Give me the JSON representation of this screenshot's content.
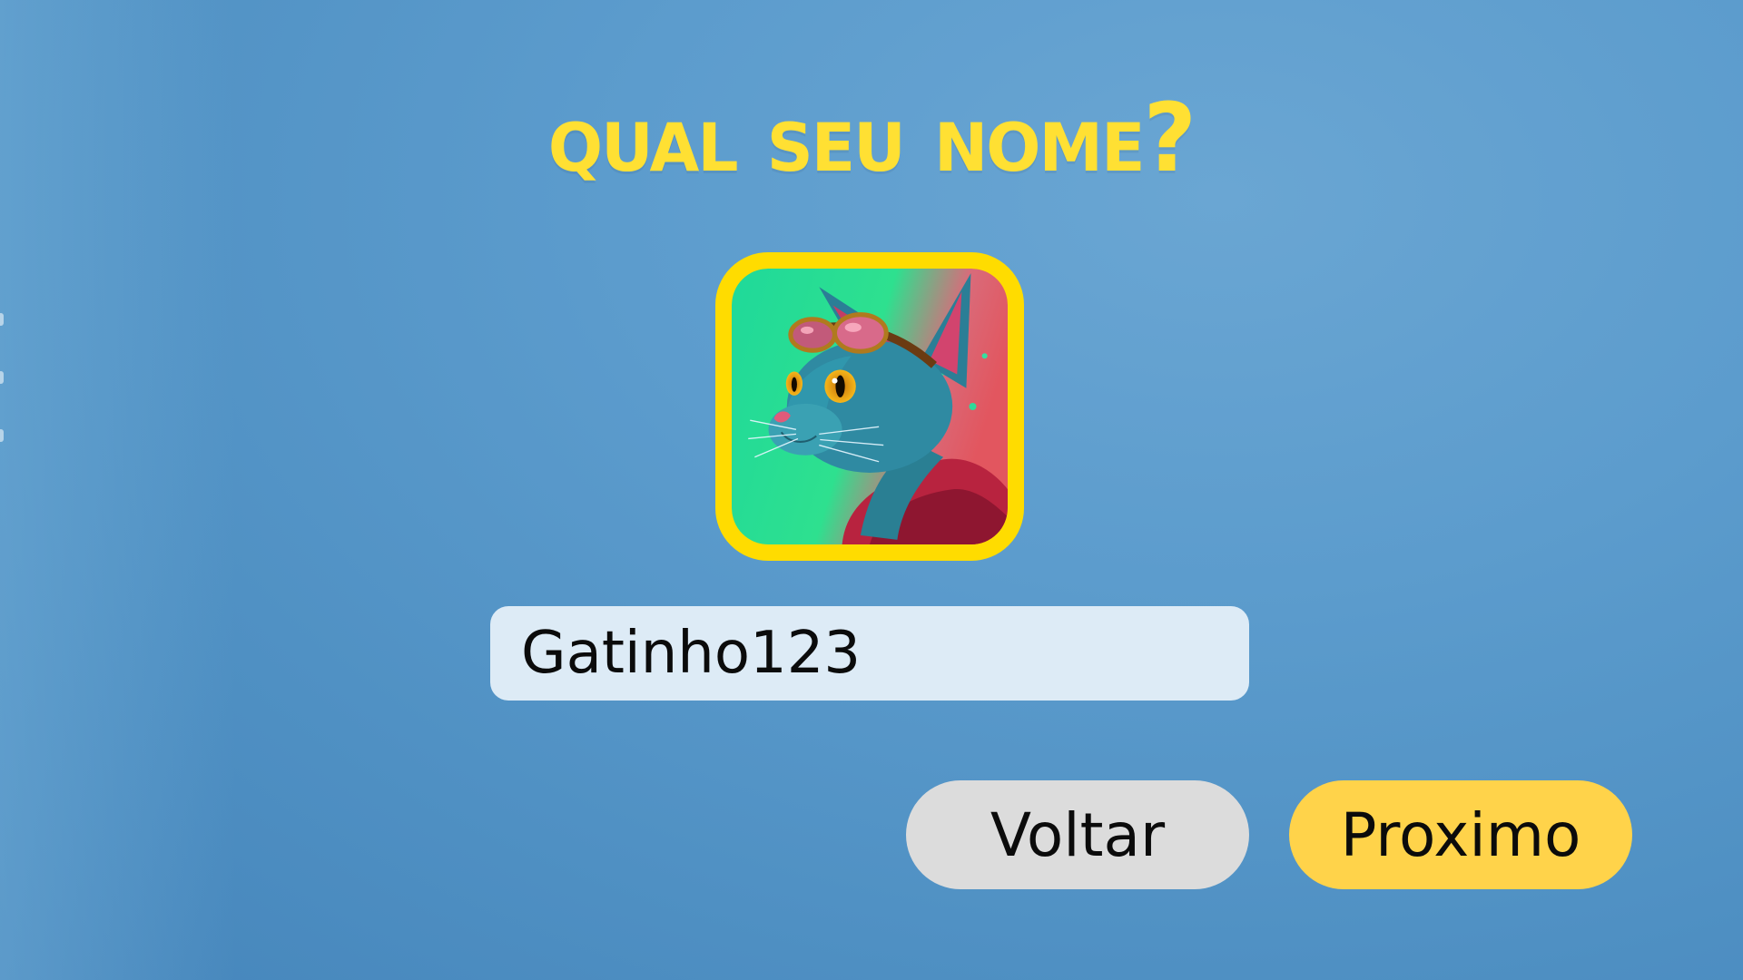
{
  "screen": {
    "title": "Qual seu nome?"
  },
  "avatar": {
    "icon": "cat-avatar-icon",
    "alt": "Gato com óculos de aviador"
  },
  "name_input": {
    "value": "Gatinho123"
  },
  "buttons": {
    "back_label": "Voltar",
    "next_label": "Proximo"
  },
  "colors": {
    "background": "#5c9ccd",
    "title": "#ffe033",
    "avatar_border": "#ffdc00",
    "input_bg": "#ddebf6",
    "back_button": "#dcdcdc",
    "next_button": "#ffd34a"
  }
}
